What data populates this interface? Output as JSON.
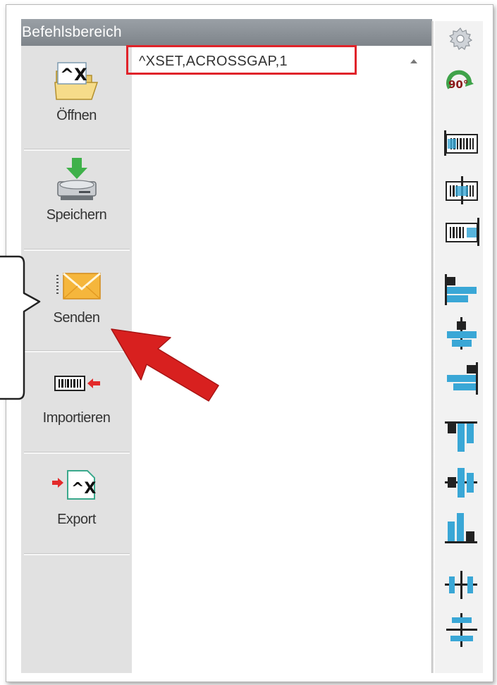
{
  "panel": {
    "title": "Befehlsbereich"
  },
  "sidebar": {
    "items": [
      {
        "label": "Öffnen",
        "icon": "open-file-icon"
      },
      {
        "label": "Speichern",
        "icon": "save-drive-icon"
      },
      {
        "label": "Senden",
        "icon": "send-envelope-icon"
      },
      {
        "label": "Importieren",
        "icon": "import-barcode-icon"
      },
      {
        "label": "Export",
        "icon": "export-file-icon"
      }
    ]
  },
  "editor": {
    "text": "^XSET,ACROSSGAP,1"
  },
  "toolbar": {
    "rotate_label": "90°",
    "items": [
      "settings-gear-icon",
      "rotate-90-icon",
      "barcode-align-left-icon",
      "barcode-align-center-icon",
      "barcode-align-right-icon",
      "align-left-icon",
      "align-center-horizontal-icon",
      "align-right-icon",
      "align-top-icon",
      "align-middle-vertical-icon",
      "align-bottom-icon",
      "distribute-horizontal-icon",
      "distribute-vertical-icon"
    ]
  },
  "colors": {
    "header": "#8a9096",
    "sidebar": "#e1e1e1",
    "highlight": "#e0232a",
    "arrow": "#d8201f",
    "toolbar_icon_blue": "#3aa7d6"
  }
}
